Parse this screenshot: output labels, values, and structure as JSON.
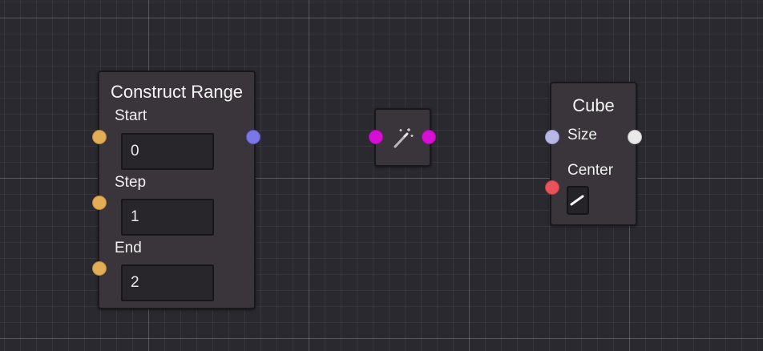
{
  "graph": {
    "nodes": {
      "construct_range": {
        "title": "Construct Range",
        "params": [
          {
            "label": "Start",
            "value": "0"
          },
          {
            "label": "Step",
            "value": "1"
          },
          {
            "label": "End",
            "value": "2"
          }
        ]
      },
      "cast": {
        "icon": "magic-wand-icon"
      },
      "cube": {
        "title": "Cube",
        "inputs": [
          {
            "label": "Size"
          },
          {
            "label": "Center"
          }
        ],
        "edit_icon": "pencil-icon"
      }
    },
    "colors": {
      "background": "#2a2930",
      "node_body": "#3a343b",
      "port_number": "#e2ad56",
      "port_range": "#7a78e6",
      "port_cast": "#d50fd4",
      "port_size": "#b9b7e3",
      "port_output": "#e9e9e9",
      "port_required": "#e8535a"
    }
  }
}
